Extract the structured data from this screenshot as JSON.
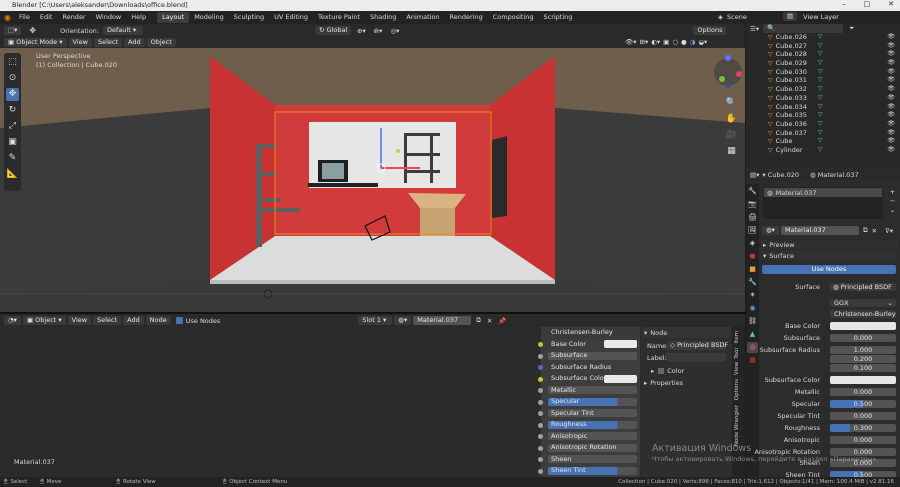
{
  "window": {
    "title": "Blender [C:\\Users\\aleksander\\Downloads\\office.blend]",
    "controls": [
      "–",
      "□",
      "✕"
    ]
  },
  "menu": {
    "items": [
      "File",
      "Edit",
      "Render",
      "Window",
      "Help"
    ],
    "workspaces": [
      "Layout",
      "Modeling",
      "Sculpting",
      "UV Editing",
      "Texture Paint",
      "Shading",
      "Animation",
      "Rendering",
      "Compositing",
      "Scripting"
    ],
    "active_workspace": "Layout",
    "scene": "Scene",
    "view_layer": "View Layer"
  },
  "viewport": {
    "orientation_label": "Orientation:",
    "orientation_value": "Default",
    "transform_orientation": "Global",
    "options": "Options",
    "mode": "Object Mode",
    "menus": [
      "View",
      "Select",
      "Add",
      "Object"
    ],
    "overlay_title": "User Perspective",
    "overlay_sub": "(1) Collection | Cube.020",
    "icons": [
      "select-box-icon",
      "cursor-icon",
      "move-icon",
      "rotate-icon",
      "scale-icon",
      "transform-icon",
      "annotate-icon",
      "measure-icon"
    ]
  },
  "node_editor": {
    "type": "Object",
    "menus": [
      "View",
      "Select",
      "Add",
      "Node"
    ],
    "use_nodes": "Use Nodes",
    "slot": "Slot 1",
    "material": "Material.037",
    "footer": "Material.037",
    "bsdf_header": "Christensen-Burley",
    "sockets": [
      {
        "label": "Base Color",
        "kind": "white",
        "dot": "#c7c729"
      },
      {
        "label": "Subsurface",
        "kind": "bar",
        "dot": "#a1a1a1"
      },
      {
        "label": "Subsurface Radius",
        "kind": "plain",
        "dot": "#6363c7"
      },
      {
        "label": "Subsurface Color",
        "kind": "white",
        "dot": "#c7c729"
      },
      {
        "label": "Metallic",
        "kind": "bar",
        "dot": "#a1a1a1"
      },
      {
        "label": "Specular",
        "kind": "fill",
        "dot": "#a1a1a1"
      },
      {
        "label": "Specular Tint",
        "kind": "bar",
        "dot": "#a1a1a1"
      },
      {
        "label": "Roughness",
        "kind": "fill",
        "dot": "#a1a1a1"
      },
      {
        "label": "Anisotropic",
        "kind": "bar",
        "dot": "#a1a1a1"
      },
      {
        "label": "Anisotropic Rotation",
        "kind": "bar",
        "dot": "#a1a1a1"
      },
      {
        "label": "Sheen",
        "kind": "bar",
        "dot": "#a1a1a1"
      },
      {
        "label": "Sheen Tint",
        "kind": "fill",
        "dot": "#a1a1a1"
      }
    ],
    "npanel": {
      "header": "Node",
      "name_label": "Name:",
      "name_value": "Principled BSDF",
      "label_label": "Label:",
      "color": "Color",
      "properties": "Properties"
    },
    "tabs": [
      "Item",
      "Tool",
      "View",
      "Options",
      "Node Wrangler"
    ]
  },
  "outliner": {
    "items": [
      "Cube.026",
      "Cube.027",
      "Cube.028",
      "Cube.029",
      "Cube.030",
      "Cube.031",
      "Cube.032",
      "Cube.033",
      "Cube.034",
      "Cube.035",
      "Cube.036",
      "Cube.037",
      "Cube",
      "Cylinder"
    ]
  },
  "properties": {
    "object": "Cube.020",
    "material": "Material.037",
    "slot_item": "Material.037",
    "material_field": "Material.037",
    "preview": "Preview",
    "surface_section": "Surface",
    "use_nodes": "Use Nodes",
    "surface_label": "Surface",
    "surface_value": "Principled BSDF",
    "distribution": "GGX",
    "subsurface_method": "Christensen-Burley",
    "rows": [
      {
        "label": "Base Color",
        "value": "",
        "style": "white"
      },
      {
        "label": "Subsurface",
        "value": "0.000",
        "style": "grey"
      },
      {
        "label": "Subsurface Radius",
        "value": "1.000",
        "style": "grey"
      },
      {
        "label": "",
        "value": "0.200",
        "style": "grey"
      },
      {
        "label": "",
        "value": "0.100",
        "style": "grey"
      },
      {
        "label": "Subsurface Color",
        "value": "",
        "style": "white"
      },
      {
        "label": "Metallic",
        "value": "0.000",
        "style": "grey"
      },
      {
        "label": "Specular",
        "value": "0.500",
        "style": "blue"
      },
      {
        "label": "Specular Tint",
        "value": "0.000",
        "style": "grey"
      },
      {
        "label": "Roughness",
        "value": "0.300",
        "style": "blue2"
      },
      {
        "label": "Anisotropic",
        "value": "0.000",
        "style": "grey"
      },
      {
        "label": "Anisotropic Rotation",
        "value": "0.000",
        "style": "grey"
      },
      {
        "label": "Sheen",
        "value": "0.000",
        "style": "grey"
      },
      {
        "label": "Sheen Tint",
        "value": "0.500",
        "style": "blue"
      }
    ]
  },
  "status": {
    "select": "Select",
    "move": "Move",
    "rotate": "Rotate View",
    "context": "Object Context Menu",
    "stats": "Collection | Cube.020 | Verts:898 | Faces:810 | Tris:1,612 | Objects:1/41 | Mem: 100.4 MiB | v2.81.16"
  },
  "watermark": {
    "line1": "Активация Windows",
    "line2": "Чтобы активировать Windows, перейдите в раздел «Параметры»."
  }
}
